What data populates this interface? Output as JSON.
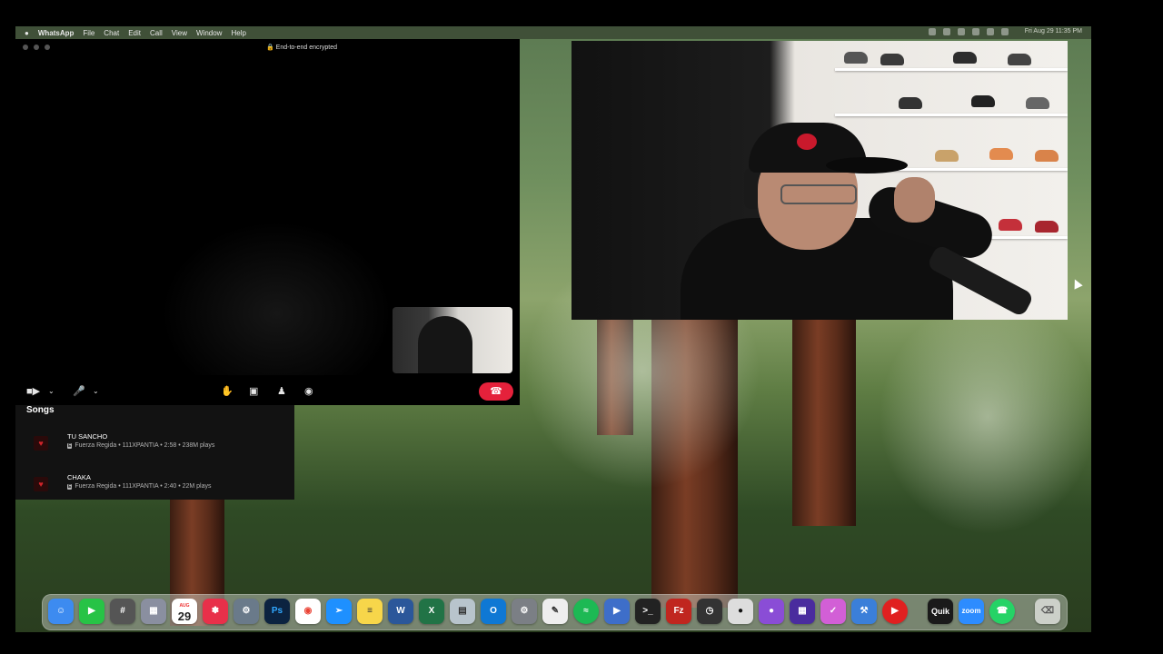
{
  "menubar": {
    "app_name": "WhatsApp",
    "menus": [
      "File",
      "Chat",
      "Edit",
      "Call",
      "View",
      "Window",
      "Help"
    ],
    "clock": "Fri Aug 29  11:35 PM"
  },
  "call_window": {
    "encryption_label": "End-to-end encrypted",
    "controls": {
      "camera_icon": "video-camera-icon",
      "mic_icon": "microphone-icon",
      "raise_hand_icon": "raise-hand-icon",
      "share_screen_icon": "share-screen-icon",
      "add_person_icon": "add-person-icon",
      "chat_icon": "chat-bubble-icon",
      "end_call_icon": "end-call-icon",
      "end_call_color": "#e5213b"
    }
  },
  "songs_panel": {
    "heading": "Songs",
    "items": [
      {
        "title": "TU SANCHO",
        "meta": "Fuerza Regida • 111XPANTIA • 2:58 • 238M plays",
        "explicit": "E"
      },
      {
        "title": "CHAKA",
        "meta": "Fuerza Regida • 111XPANTIA • 2:40 • 22M plays",
        "explicit": "E"
      }
    ]
  },
  "dock": {
    "calendar_month": "AUG",
    "calendar_day": "29",
    "apps": [
      "Finder",
      "FaceTime",
      "Calculator",
      "Launchpad",
      "Calendar",
      "Scrobbles",
      "Motion",
      "Photoshop",
      "Chrome",
      "Safari",
      "Notes",
      "Word",
      "Excel",
      "Preview",
      "Outlook",
      "System Settings",
      "TextEdit",
      "Spotify",
      "QuickTime",
      "Terminal",
      "FileZilla",
      "Activity Monitor",
      "Panda",
      "Notchmeister",
      "Streamdeck",
      "Things",
      "Xcode",
      "YouTube",
      "Quik",
      "Zoom",
      "WhatsApp",
      "Trash"
    ],
    "labels": {
      "photoshop": "Ps",
      "word": "W",
      "excel": "X",
      "outlook": "O",
      "quik": "Quik",
      "zoom": "zoom",
      "filezilla": "Fz"
    }
  }
}
